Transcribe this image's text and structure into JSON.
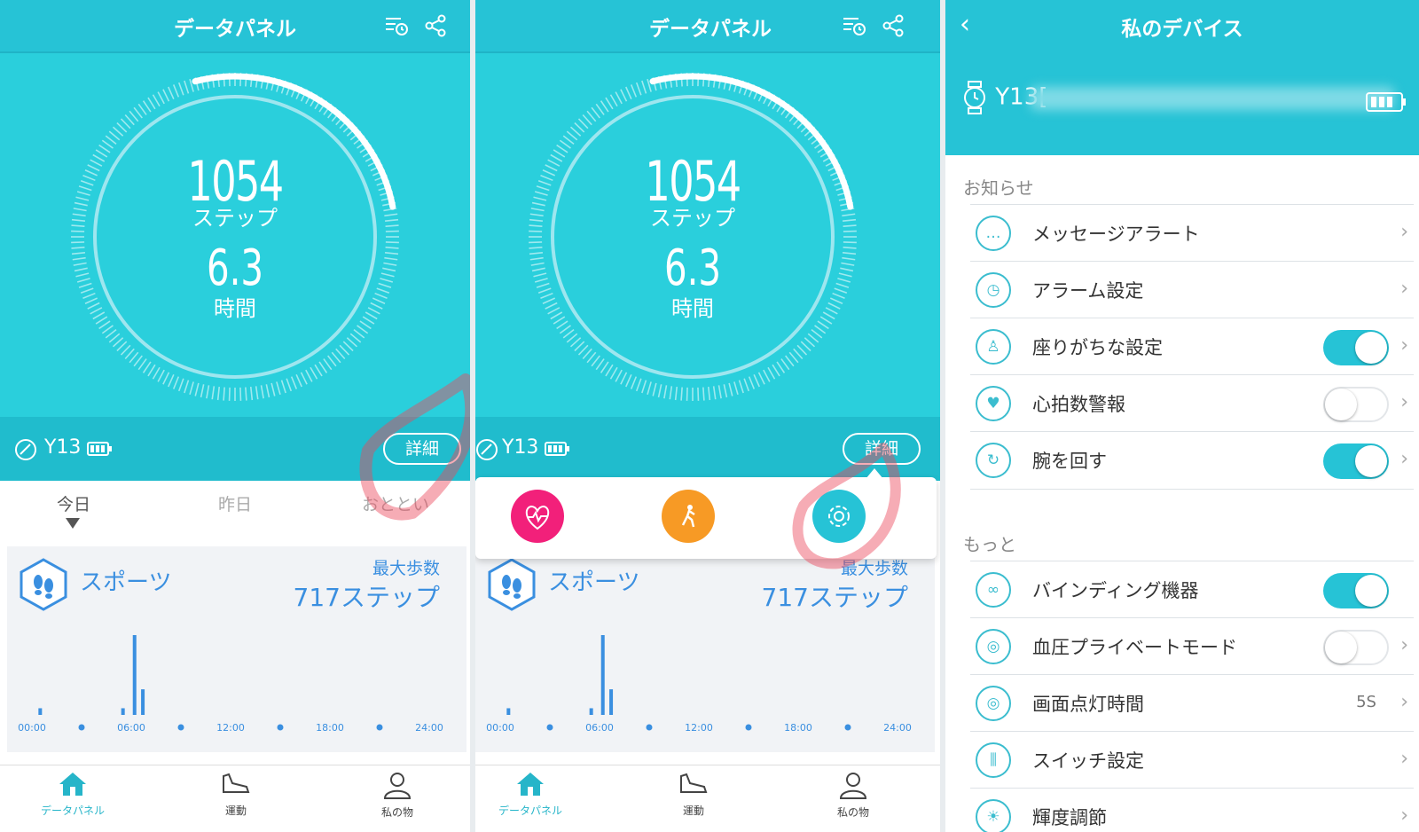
{
  "colors": {
    "accent": "#26c3d6",
    "hero": "#2acfdc",
    "blue": "#3a8fe0",
    "pink": "#f2207a",
    "orange": "#f79a25"
  },
  "dashboard": {
    "title": "データパネル",
    "steps": "1054",
    "steps_label": "ステップ",
    "hours": "6.3",
    "hours_label": "時間",
    "ring_progress": 0.26,
    "device_name": "Y13",
    "detail_button": "詳細",
    "days": [
      "今日",
      "昨日",
      "おととい"
    ],
    "sport_title": "スポーツ",
    "max_steps_label": "最大歩数",
    "max_steps_value": "717ステップ",
    "nav": [
      "データパネル",
      "運動",
      "私の物"
    ]
  },
  "chart_data": {
    "type": "bar",
    "x_ticks": [
      "00:00",
      "06:00",
      "12:00",
      "18:00",
      "24:00"
    ],
    "bars": [
      {
        "hour": 0.5,
        "value": 60
      },
      {
        "hour": 5.5,
        "value": 60
      },
      {
        "hour": 6.2,
        "value": 717
      },
      {
        "hour": 6.7,
        "value": 230
      }
    ],
    "ylim": [
      0,
      717
    ]
  },
  "device": {
    "title": "私のデバイス",
    "name": "Y13[",
    "section_notice": "お知らせ",
    "section_more": "もっと",
    "rows": [
      {
        "label": "メッセージアラート",
        "icon": "message-icon",
        "toggle": null
      },
      {
        "label": "アラーム設定",
        "icon": "alarm-icon",
        "toggle": null
      },
      {
        "label": "座りがちな設定",
        "icon": "sedentary-icon",
        "toggle": "on"
      },
      {
        "label": "心拍数警報",
        "icon": "heart-icon",
        "toggle": "off"
      },
      {
        "label": "腕を回す",
        "icon": "wrist-icon",
        "toggle": "on"
      }
    ],
    "rows_more": [
      {
        "label": "バインディング機器",
        "icon": "link-icon",
        "toggle": "on"
      },
      {
        "label": "血圧プライベートモード",
        "icon": "blood-pressure-icon",
        "toggle": "off"
      },
      {
        "label": "画面点灯時間",
        "icon": "screen-icon",
        "value": "5S"
      },
      {
        "label": "スイッチ設定",
        "icon": "switch-icon"
      },
      {
        "label": "輝度調節",
        "icon": "brightness-icon"
      }
    ]
  }
}
